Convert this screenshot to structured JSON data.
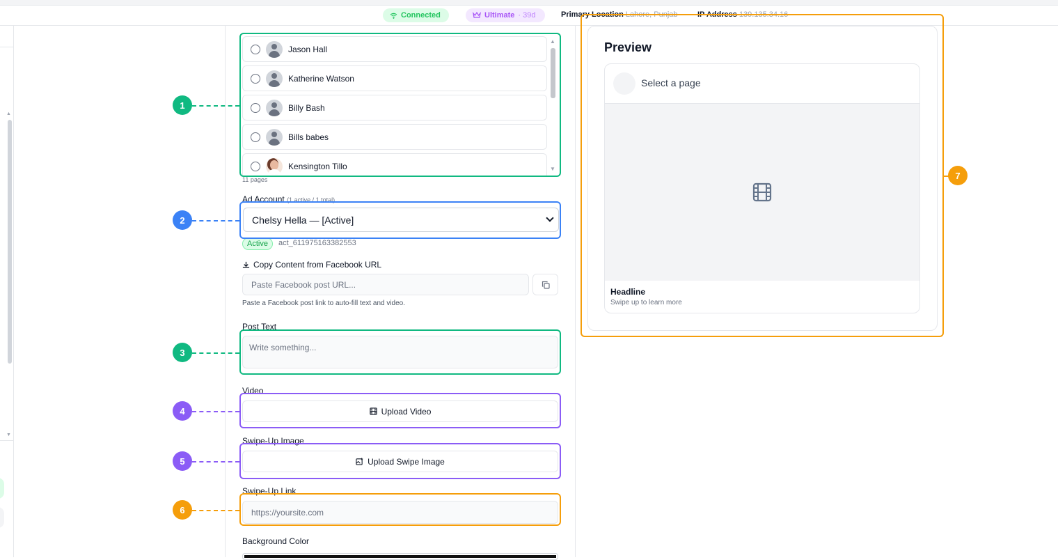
{
  "status": {
    "connected": "Connected",
    "plan": "Ultimate",
    "plan_days": "· 39d",
    "primary_location_label": "Primary Location",
    "primary_location_value": "Lahore, Punjab",
    "ip_label": "IP Address",
    "ip_value": "139.135.34.16"
  },
  "pages": {
    "items": [
      {
        "name": "Jason Hall",
        "avatar": "default-avatar"
      },
      {
        "name": "Katherine Watson",
        "avatar": "default-avatar"
      },
      {
        "name": "Billy Bash",
        "avatar": "default-avatar"
      },
      {
        "name": "Bills babes",
        "avatar": "default-avatar"
      },
      {
        "name": "Kensington Tillo",
        "avatar": "photo-avatar"
      }
    ],
    "count_text": "11 pages"
  },
  "ad_account": {
    "label": "Ad Account",
    "meta": "(1 active / 1 total)",
    "selected": "Chelsy Hella — [Active]",
    "status_badge": "Active",
    "account_id": "act_611975163382553"
  },
  "copy_content": {
    "label": "Copy Content from Facebook URL",
    "placeholder": "Paste Facebook post URL...",
    "hint": "Paste a Facebook post link to auto-fill text and video."
  },
  "post_text": {
    "label": "Post Text",
    "placeholder": "Write something..."
  },
  "video": {
    "label": "Video",
    "button": "Upload Video"
  },
  "swipe_image": {
    "label": "Swipe-Up Image",
    "button": "Upload Swipe Image"
  },
  "swipe_link": {
    "label": "Swipe-Up Link",
    "placeholder": "https://yoursite.com"
  },
  "background_color": {
    "label": "Background Color"
  },
  "preview": {
    "title": "Preview",
    "page_placeholder": "Select a page",
    "headline": "Headline",
    "swipe_text": "Swipe up to learn more"
  },
  "annotations": [
    "1",
    "2",
    "3",
    "4",
    "5",
    "6",
    "7"
  ],
  "colors": {
    "green": "#10b981",
    "blue": "#3b82f6",
    "purple": "#8b5cf6",
    "orange": "#f59e0b"
  }
}
